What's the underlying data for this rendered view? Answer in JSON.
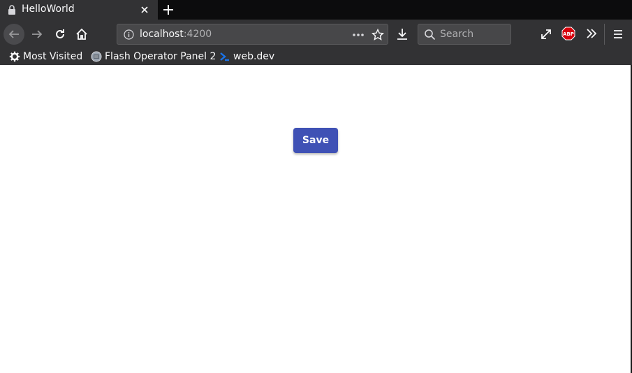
{
  "tab": {
    "title": "HelloWorld",
    "icons": [
      "lock-icon",
      "close-icon",
      "plus-icon"
    ]
  },
  "navbar": {
    "url_host": "localhost",
    "url_port": ":4200",
    "search_placeholder": "Search",
    "icons": [
      "back-arrow-icon",
      "forward-arrow-icon",
      "reload-icon",
      "home-icon",
      "info-icon",
      "more-dots-icon",
      "star-icon",
      "download-icon",
      "search-icon",
      "fullscreen-icon",
      "adblock-icon",
      "overflow-chevron-icon",
      "hamburger-menu-icon"
    ],
    "adblock_text": "ABP"
  },
  "bookmarks": [
    {
      "label": "Most Visited",
      "icon": "gear-icon"
    },
    {
      "label": "Flash Operator Panel 2",
      "icon": "panel-favicon-icon"
    },
    {
      "label": "web.dev",
      "icon": "webdev-favicon-icon"
    }
  ],
  "content": {
    "save_label": "Save"
  },
  "colors": {
    "chrome_dark": "#323234",
    "tabstrip": "#0c0c0d",
    "save_button": "#3f51b5"
  }
}
